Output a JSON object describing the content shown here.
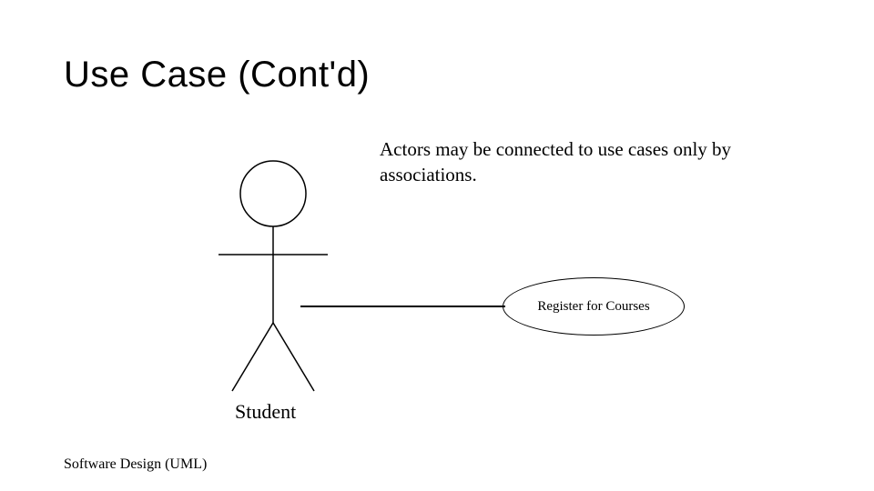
{
  "title": "Use Case (Cont'd)",
  "body_text": "Actors may be connected to use cases only by associations.",
  "actor_label": "Student",
  "usecase_label": "Register for Courses",
  "footer": "Software Design (UML)"
}
